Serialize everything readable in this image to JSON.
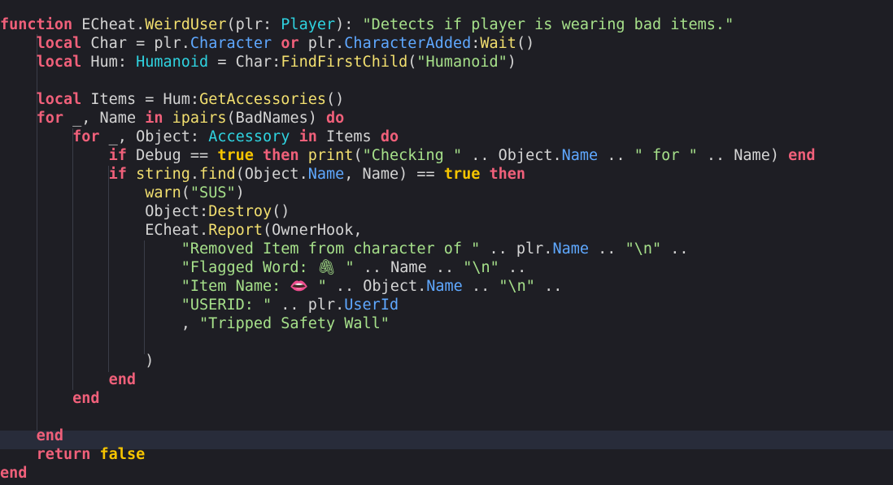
{
  "editor": {
    "colors": {
      "background": "#1e1e24",
      "keyword": "#f0607a",
      "boolean": "#f5c400",
      "string": "#a6e08a",
      "function": "#f2df6f",
      "type": "#2fd3e0",
      "property": "#5fa8ff",
      "text": "#d4d4d4"
    },
    "current_line": 24,
    "lines": [
      [
        [
          "kw",
          "function"
        ],
        [
          "txt",
          " ECheat."
        ],
        [
          "fn",
          "WeirdUser"
        ],
        [
          "txt",
          "(plr: "
        ],
        [
          "type",
          "Player"
        ],
        [
          "txt",
          "): "
        ],
        [
          "str",
          "\"Detects if player is wearing bad items.\""
        ]
      ],
      [
        [
          "txt",
          "    "
        ],
        [
          "kw",
          "local"
        ],
        [
          "txt",
          " Char = plr."
        ],
        [
          "prop",
          "Character"
        ],
        [
          "txt",
          " "
        ],
        [
          "kw",
          "or"
        ],
        [
          "txt",
          " plr."
        ],
        [
          "prop",
          "CharacterAdded"
        ],
        [
          "txt",
          ":"
        ],
        [
          "fn",
          "Wait"
        ],
        [
          "txt",
          "()"
        ]
      ],
      [
        [
          "txt",
          "    "
        ],
        [
          "kw",
          "local"
        ],
        [
          "txt",
          " Hum: "
        ],
        [
          "type",
          "Humanoid"
        ],
        [
          "txt",
          " = Char:"
        ],
        [
          "fn",
          "FindFirstChild"
        ],
        [
          "txt",
          "("
        ],
        [
          "str",
          "\"Humanoid\""
        ],
        [
          "txt",
          ")"
        ]
      ],
      [],
      [
        [
          "txt",
          "    "
        ],
        [
          "kw",
          "local"
        ],
        [
          "txt",
          " Items = Hum:"
        ],
        [
          "fn",
          "GetAccessories"
        ],
        [
          "txt",
          "()"
        ]
      ],
      [
        [
          "txt",
          "    "
        ],
        [
          "kw",
          "for"
        ],
        [
          "txt",
          " _, Name "
        ],
        [
          "kw",
          "in"
        ],
        [
          "txt",
          " "
        ],
        [
          "fn",
          "ipairs"
        ],
        [
          "txt",
          "(BadNames) "
        ],
        [
          "kw",
          "do"
        ]
      ],
      [
        [
          "txt",
          "        "
        ],
        [
          "kw",
          "for"
        ],
        [
          "txt",
          " _, Object: "
        ],
        [
          "type",
          "Accessory"
        ],
        [
          "txt",
          " "
        ],
        [
          "kw",
          "in"
        ],
        [
          "txt",
          " Items "
        ],
        [
          "kw",
          "do"
        ]
      ],
      [
        [
          "txt",
          "            "
        ],
        [
          "kw",
          "if"
        ],
        [
          "txt",
          " Debug == "
        ],
        [
          "bool",
          "true"
        ],
        [
          "txt",
          " "
        ],
        [
          "kw",
          "then"
        ],
        [
          "txt",
          " "
        ],
        [
          "fn",
          "print"
        ],
        [
          "txt",
          "("
        ],
        [
          "str",
          "\"Checking \""
        ],
        [
          "txt",
          " .. Object."
        ],
        [
          "prop",
          "Name"
        ],
        [
          "txt",
          " .. "
        ],
        [
          "str",
          "\" for \""
        ],
        [
          "txt",
          " .. Name) "
        ],
        [
          "kw",
          "end"
        ]
      ],
      [
        [
          "txt",
          "            "
        ],
        [
          "kw",
          "if"
        ],
        [
          "txt",
          " "
        ],
        [
          "fn",
          "string"
        ],
        [
          "txt",
          "."
        ],
        [
          "fn",
          "find"
        ],
        [
          "txt",
          "(Object."
        ],
        [
          "prop",
          "Name"
        ],
        [
          "txt",
          ", Name) == "
        ],
        [
          "bool",
          "true"
        ],
        [
          "txt",
          " "
        ],
        [
          "kw",
          "then"
        ]
      ],
      [
        [
          "txt",
          "                "
        ],
        [
          "fn",
          "warn"
        ],
        [
          "txt",
          "("
        ],
        [
          "str",
          "\"SUS\""
        ],
        [
          "txt",
          ")"
        ]
      ],
      [
        [
          "txt",
          "                Object:"
        ],
        [
          "fn",
          "Destroy"
        ],
        [
          "txt",
          "()"
        ]
      ],
      [
        [
          "txt",
          "                ECheat."
        ],
        [
          "fn",
          "Report"
        ],
        [
          "txt",
          "(OwnerHook,"
        ]
      ],
      [
        [
          "txt",
          "                    "
        ],
        [
          "str",
          "\"Removed Item from character of \""
        ],
        [
          "txt",
          " .. plr."
        ],
        [
          "prop",
          "Name"
        ],
        [
          "txt",
          " .. "
        ],
        [
          "str",
          "\"\\n\""
        ],
        [
          "txt",
          " .."
        ]
      ],
      [
        [
          "txt",
          "                    "
        ],
        [
          "str",
          "\"Flagged Word: 🖇 \""
        ],
        [
          "txt",
          " .. Name .. "
        ],
        [
          "str",
          "\"\\n\""
        ],
        [
          "txt",
          " .."
        ]
      ],
      [
        [
          "txt",
          "                    "
        ],
        [
          "str",
          "\"Item Name: 👄 \""
        ],
        [
          "txt",
          " .. Object."
        ],
        [
          "prop",
          "Name"
        ],
        [
          "txt",
          " .. "
        ],
        [
          "str",
          "\"\\n\""
        ],
        [
          "txt",
          " .."
        ]
      ],
      [
        [
          "txt",
          "                    "
        ],
        [
          "str",
          "\"USERID: \""
        ],
        [
          "txt",
          " .. plr."
        ],
        [
          "prop",
          "UserId"
        ]
      ],
      [
        [
          "txt",
          "                    , "
        ],
        [
          "str",
          "\"Tripped Safety Wall\""
        ]
      ],
      [],
      [
        [
          "txt",
          "                )"
        ]
      ],
      [
        [
          "txt",
          "            "
        ],
        [
          "kw",
          "end"
        ]
      ],
      [
        [
          "txt",
          "        "
        ],
        [
          "kw",
          "end"
        ]
      ],
      [],
      [
        [
          "txt",
          "    "
        ],
        [
          "kw",
          "end"
        ]
      ],
      [
        [
          "txt",
          "    "
        ],
        [
          "kw",
          "return"
        ],
        [
          "txt",
          " "
        ],
        [
          "bool",
          "false"
        ]
      ],
      [
        [
          "kw",
          "end"
        ]
      ]
    ]
  }
}
